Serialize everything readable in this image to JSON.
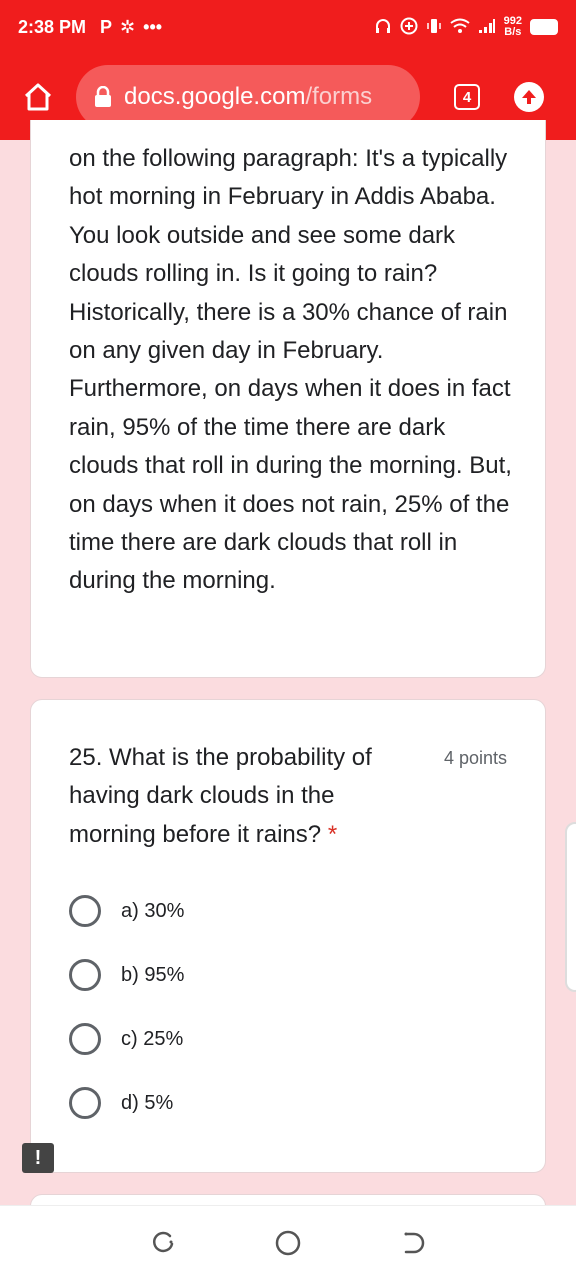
{
  "status_bar": {
    "time": "2:38 PM",
    "app_badge": "P",
    "more": "•••",
    "net_speed_value": "992",
    "net_speed_unit": "B/s"
  },
  "browser": {
    "url_host": "docs.google.com",
    "url_path": "/forms",
    "tab_count": "4"
  },
  "form": {
    "context_paragraph": "on the following paragraph: It's a typically hot morning in February in Addis Ababa. You look outside and see some dark clouds rolling in. Is it going to rain? Historically, there is a 30% chance of rain on any given day in February. Furthermore, on days when it does in fact rain, 95% of the time there are dark clouds that roll in during the morning. But, on days when it does not rain, 25% of the time there are dark clouds that roll in during the morning.",
    "question": {
      "text": "25. What is the probability of having dark clouds in the morning before it rains?",
      "required_marker": "*",
      "points": "4 points",
      "options": [
        {
          "label": "a) 30%"
        },
        {
          "label": "b) 95%"
        },
        {
          "label": "c) 25%"
        },
        {
          "label": "d) 5%"
        }
      ]
    }
  },
  "feedback_icon": "!",
  "colors": {
    "brand_red": "#f01d1d",
    "page_background": "#fbdcdf",
    "required_red": "#d93025"
  }
}
